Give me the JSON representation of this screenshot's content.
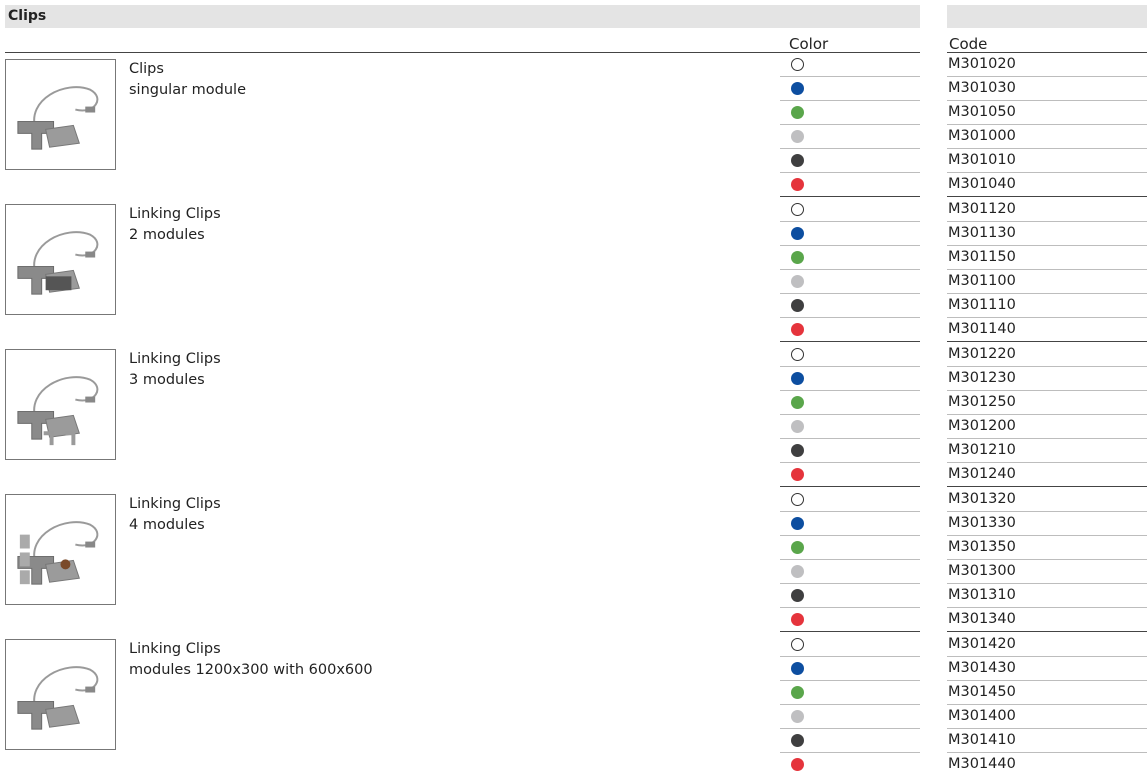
{
  "section_title": "Clips",
  "headers": {
    "color": "Color",
    "code": "Code"
  },
  "color_swatches": [
    {
      "name": "white",
      "hex": "#ffffff"
    },
    {
      "name": "blue",
      "hex": "#0d4ea0"
    },
    {
      "name": "green",
      "hex": "#5aa64b"
    },
    {
      "name": "light-grey",
      "hex": "#bfbfc1"
    },
    {
      "name": "dark-grey",
      "hex": "#3f3f40"
    },
    {
      "name": "red",
      "hex": "#e5343c"
    }
  ],
  "products": [
    {
      "name": "Clips",
      "description": "singular module",
      "image": "clip-single",
      "codes": [
        "M301020",
        "M301030",
        "M301050",
        "M301000",
        "M301010",
        "M301040"
      ]
    },
    {
      "name": "Linking Clips",
      "description": "2 modules",
      "image": "clip-link-2",
      "codes": [
        "M301120",
        "M301130",
        "M301150",
        "M301100",
        "M301110",
        "M301140"
      ]
    },
    {
      "name": "Linking Clips",
      "description": "3 modules",
      "image": "clip-link-3",
      "codes": [
        "M301220",
        "M301230",
        "M301250",
        "M301200",
        "M301210",
        "M301240"
      ]
    },
    {
      "name": "Linking Clips",
      "description": "4 modules",
      "image": "clip-link-4",
      "codes": [
        "M301320",
        "M301330",
        "M301350",
        "M301300",
        "M301310",
        "M301340"
      ]
    },
    {
      "name": "Linking Clips",
      "description": "modules 1200x300 with 600x600",
      "image": "clip-link-mixed",
      "codes": [
        "M301420",
        "M301430",
        "M301450",
        "M301400",
        "M301410",
        "M301440"
      ]
    }
  ]
}
